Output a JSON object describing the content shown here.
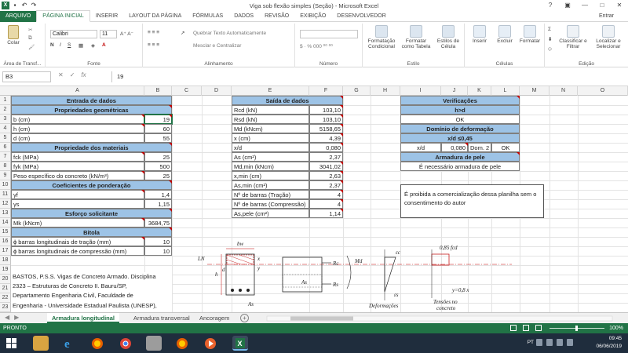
{
  "window": {
    "title": "Viga sob flexão simples (Seção) - Microsoft Excel",
    "user": "Entrar"
  },
  "ribbon_tabs": [
    "ARQUIVO",
    "PÁGINA INICIAL",
    "INSERIR",
    "LAYOUT DA PÁGINA",
    "FÓRMULAS",
    "DADOS",
    "REVISÃO",
    "EXIBIÇÃO",
    "DESENVOLVEDOR"
  ],
  "ribbon": {
    "paste_label": "Colar",
    "font_name": "Calibri",
    "font_size": "11",
    "wrap_text": "Quebrar Texto Automaticamente",
    "merge_center": "Mesclar e Centralizar",
    "groups": {
      "clipboard": "Área de Transf...",
      "font": "Fonte",
      "alignment": "Alinhamento",
      "number": "Número",
      "style": "Estilo",
      "cells": "Células",
      "editing": "Edição"
    },
    "style_buttons": [
      "Formatação Condicional",
      "Formatar como Tabela",
      "Estilos de Célula"
    ],
    "cell_buttons": [
      "Inserir",
      "Excluir",
      "Formatar"
    ],
    "edit_buttons": [
      "Classificar e Filtrar",
      "Localizar e Selecionar"
    ]
  },
  "formula_bar": {
    "name_box": "B3",
    "value": "19"
  },
  "columns": [
    "A",
    "B",
    "C",
    "D",
    "E",
    "F",
    "G",
    "H",
    "I",
    "J",
    "K",
    "L",
    "M",
    "N",
    "O"
  ],
  "rows": [
    "1",
    "2",
    "3",
    "4",
    "5",
    "6",
    "7",
    "8",
    "9",
    "10",
    "11",
    "12",
    "13",
    "14",
    "15",
    "16",
    "17",
    "18",
    "19",
    "20",
    "21",
    "22",
    "23"
  ],
  "entrada": {
    "title": "Entrada de dados",
    "sec_geom": "Propriedades geométricas",
    "bw_label": "b (cm)",
    "bw_value": "19",
    "h_label": "h (cm)",
    "h_value": "60",
    "d_label": "d (cm)",
    "d_value": "55",
    "sec_mat": "Propriedade dos materiais",
    "fck_label": "fck (MPa)",
    "fck_value": "25",
    "fyk_label": "fyk (MPa)",
    "fyk_value": "500",
    "peso_label": "Peso específico do concreto (kN/m³)",
    "peso_value": "25",
    "sec_coef": "Coeficientes de ponderação",
    "gf_label": "γf",
    "gf_value": "1,4",
    "gs_label": "γs",
    "gs_value": "1,15",
    "sec_esf": "Esforço solicitante",
    "mk_label": "Mk (kNcm)",
    "mk_value": "3684,75",
    "sec_bit": "Bitola",
    "phi_t_label": "ϕ barras longitudinais de tração (mm)",
    "phi_t_value": "10",
    "phi_c_label": "ϕ barras longitudinais de compressão (mm)",
    "phi_c_value": "10"
  },
  "saida": {
    "title": "Saída de dados",
    "rows": [
      {
        "label": "Rcd (kN)",
        "value": "103,10"
      },
      {
        "label": "Rsd (kN)",
        "value": "103,10"
      },
      {
        "label": "Md (kNcm)",
        "value": "5158,65"
      },
      {
        "label": "x (cm)",
        "value": "4,39"
      },
      {
        "label": "x/d",
        "value": "0,080"
      },
      {
        "label": "As (cm²)",
        "value": "2,37"
      },
      {
        "label": "Md,min (kNcm)",
        "value": "3041,02"
      },
      {
        "label": "x,min (cm)",
        "value": "2,63"
      },
      {
        "label": "As,min (cm²)",
        "value": "2,37"
      },
      {
        "label": "Nº de barras (Tração)",
        "value": "4"
      },
      {
        "label": "Nº de barras (Compressão)",
        "value": "4"
      },
      {
        "label": "As,pele (cm²)",
        "value": "1,14"
      }
    ]
  },
  "verificacoes": {
    "title": "Verificações",
    "h_gt_d": "h>d",
    "ok1": "OK",
    "dom_title": "Domínio de deformação",
    "xd_limit": "x/d ≤0,45",
    "xd_label": "x/d",
    "xd_value": "0,080",
    "dom": "Dom. 2",
    "ok2": "OK",
    "pele_title": "Armadura de pele",
    "pele_msg": "É necessário armadura de pele"
  },
  "note": "É proibida a comercialização dessa planilha sem o consentimento do autor",
  "reference": {
    "line1": "BASTOS, P.S.S. Vigas de Concreto Armado. Disciplina",
    "line2": "2323 – Estruturas de Concreto II. Bauru/SP,",
    "line3": "Departamento Engenharia Civil, Faculdade de",
    "line4": "Engenharia - Universidade Estadual Paulista (UNESP),"
  },
  "diagram": {
    "bw": "bw",
    "ln": "LN",
    "h": "h",
    "d": "d",
    "x": "x",
    "y": "y",
    "as1": "As",
    "as2": "As",
    "rc": "Rc",
    "rs": "Rs",
    "md": "Md",
    "ec": "εc",
    "es": "εs",
    "deformacoes": "Deformações",
    "tensoes_line1": "Tensões no",
    "tensoes_line2": "concreto",
    "fcd": "0,85 fcd",
    "y08": "y=0,8 x"
  },
  "sheets": [
    "Armadura longitudinal",
    "Armadura transversal",
    "Ancoragem"
  ],
  "status": {
    "ready": "PRONTO",
    "zoom": "100%"
  },
  "taskbar": {
    "lang": "PT",
    "time": "09:45",
    "date": "06/06/2019"
  },
  "colors": {
    "excel_green": "#217346",
    "header_blue": "#9dc3e6",
    "comment_red": "#c00000"
  }
}
